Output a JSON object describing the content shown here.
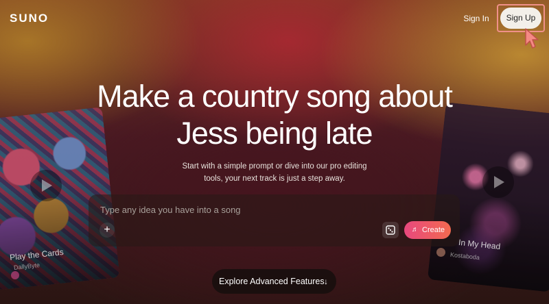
{
  "header": {
    "logo": "SUNO",
    "sign_in_label": "Sign In",
    "sign_up_label": "Sign Up"
  },
  "hero": {
    "title_line1": "Make a country song about",
    "title_line2": "Jess being late",
    "subtitle_line1": "Start with a simple prompt or dive into our pro editing",
    "subtitle_line2": "tools, your next track is just a step away."
  },
  "prompt": {
    "placeholder": "Type any idea you have into a song",
    "add_icon": "+",
    "create_icon": "♬",
    "create_label": "Create"
  },
  "cards": [
    {
      "title": "Play the Cards",
      "artist": "DallyByte"
    },
    {
      "title": "In My Head",
      "artist": "Kostaboda"
    }
  ],
  "explore": {
    "label": "Explore Advanced Features",
    "arrow": "↓"
  },
  "colors": {
    "create_gradient_start": "#e8487e",
    "create_gradient_end": "#f26a50",
    "highlight_border": "#f0908a",
    "signup_bg": "#f3efe9"
  }
}
